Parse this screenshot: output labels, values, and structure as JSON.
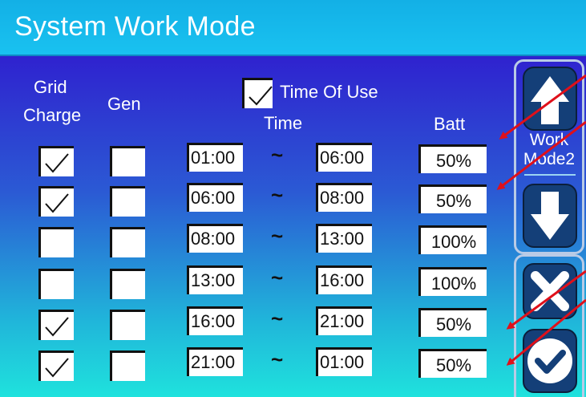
{
  "header": {
    "title": "System Work Mode"
  },
  "columns": {
    "grid_charge_line1": "Grid",
    "grid_charge_line2": "Charge",
    "gen": "Gen",
    "time": "Time",
    "batt": "Batt"
  },
  "time_of_use": {
    "label": "Time Of Use",
    "checked": true
  },
  "separator": "~",
  "rows": [
    {
      "grid_charge": true,
      "gen": false,
      "start": "01:00",
      "end": "06:00",
      "batt": "50%"
    },
    {
      "grid_charge": true,
      "gen": false,
      "start": "06:00",
      "end": "08:00",
      "batt": "50%"
    },
    {
      "grid_charge": false,
      "gen": false,
      "start": "08:00",
      "end": "13:00",
      "batt": "100%"
    },
    {
      "grid_charge": false,
      "gen": false,
      "start": "13:00",
      "end": "16:00",
      "batt": "100%"
    },
    {
      "grid_charge": true,
      "gen": false,
      "start": "16:00",
      "end": "21:00",
      "batt": "50%"
    },
    {
      "grid_charge": true,
      "gen": false,
      "start": "21:00",
      "end": "01:00",
      "batt": "50%"
    }
  ],
  "side": {
    "work_mode_line1": "Work",
    "work_mode_line2": "Mode2",
    "up_icon": "arrow-up-icon",
    "down_icon": "arrow-down-icon",
    "cancel_icon": "close-icon",
    "confirm_icon": "checkmark-icon"
  },
  "annotation_color": "#e0101a"
}
